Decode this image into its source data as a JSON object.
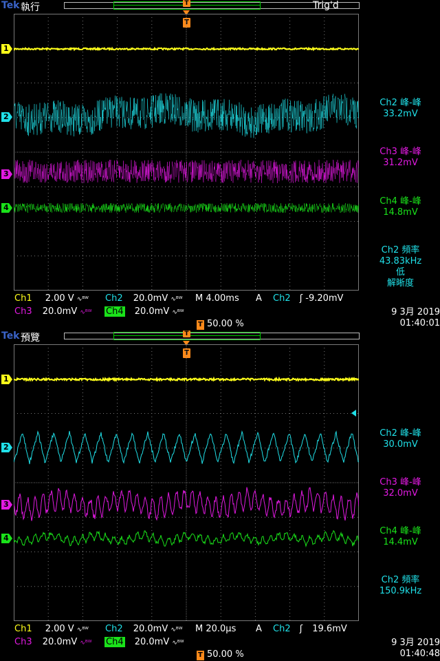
{
  "brand": "Tek",
  "colors": {
    "ch1": "#ffff1a",
    "ch2": "#20e0e8",
    "ch3": "#e21ae2",
    "ch4": "#1ae21a",
    "trigger": "#ff8a1a",
    "graticule": "#7a7a7a"
  },
  "screens": [
    {
      "mode": "執行",
      "trig_status": "Trig'd",
      "trigger_marker": "T",
      "channel_markers": [
        "1",
        "2",
        "3",
        "4"
      ],
      "measurements": [
        {
          "label": "Ch2 峰-峰",
          "value": "33.2mV",
          "channel": "ch2"
        },
        {
          "label": "Ch3 峰-峰",
          "value": "31.2mV",
          "channel": "ch3"
        },
        {
          "label": "Ch4 峰-峰",
          "value": "14.8mV",
          "channel": "ch4"
        }
      ],
      "freq": {
        "label": "Ch2 頻率",
        "value": "43.83kHz",
        "note1": "低",
        "note2": "解晰度"
      },
      "ch1": {
        "name": "Ch1",
        "scale": "2.00 V"
      },
      "ch2": {
        "name": "Ch2",
        "scale": "20.0mV"
      },
      "ch3": {
        "name": "Ch3",
        "scale": "20.0mV"
      },
      "ch4": {
        "name": "Ch4",
        "scale": "20.0mV"
      },
      "timebase": "M 4.00ms",
      "acq": "A",
      "trig_source": "Ch2",
      "trig_level": "-9.20mV",
      "trig_pos": "50.00 %",
      "date": "9 3月  2019",
      "time": "01:40:01"
    },
    {
      "mode": "預覽",
      "trig_status": "",
      "trigger_marker": "T",
      "channel_markers": [
        "1",
        "2",
        "3",
        "4"
      ],
      "measurements": [
        {
          "label": "Ch2 峰-峰",
          "value": "30.0mV",
          "channel": "ch2"
        },
        {
          "label": "Ch3 峰-峰",
          "value": "32.0mV",
          "channel": "ch3"
        },
        {
          "label": "Ch4 峰-峰",
          "value": "14.4mV",
          "channel": "ch4"
        }
      ],
      "freq": {
        "label": "Ch2 頻率",
        "value": "150.9kHz",
        "note1": "",
        "note2": ""
      },
      "ch1": {
        "name": "Ch1",
        "scale": "2.00 V"
      },
      "ch2": {
        "name": "Ch2",
        "scale": "20.0mV"
      },
      "ch3": {
        "name": "Ch3",
        "scale": "20.0mV"
      },
      "ch4": {
        "name": "Ch4",
        "scale": "20.0mV"
      },
      "timebase": "M 20.0µs",
      "acq": "A",
      "trig_source": "Ch2",
      "trig_level": "19.6mV",
      "trig_pos": "50.00 %",
      "date": "9 3月  2019",
      "time": "01:40:48"
    }
  ]
}
